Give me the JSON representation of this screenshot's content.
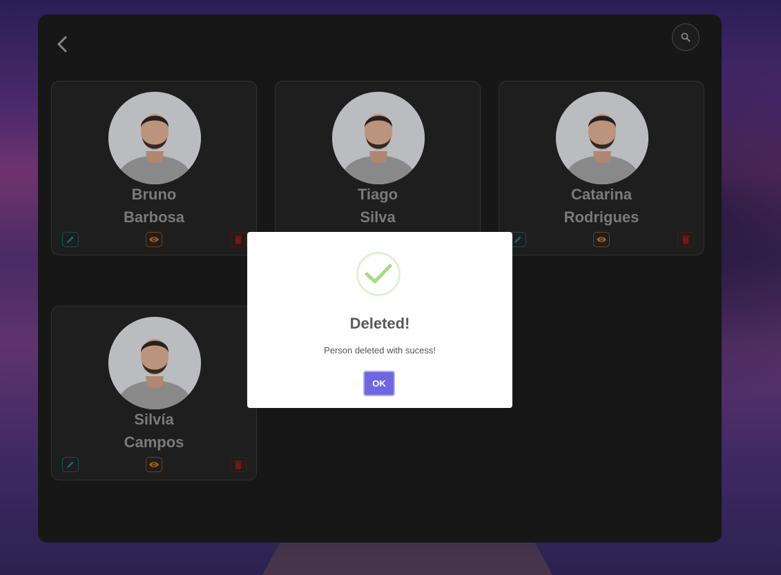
{
  "colors": {
    "panel": "#1b1b1b",
    "card_border": "#3a3a3a",
    "name_text": "#8b8b8b",
    "edit_accent": "#1e6f7c",
    "view_accent": "#c06a10",
    "delete_accent": "#8a1818",
    "success_check": "#a5dc86",
    "ok_button": "#7066e0"
  },
  "header": {
    "back_icon": "chevron-left-icon",
    "search_icon": "search-icon"
  },
  "people": [
    {
      "first_name": "Bruno",
      "last_name": "Barbosa"
    },
    {
      "first_name": "Tiago",
      "last_name": "Silva"
    },
    {
      "first_name": "Catarina",
      "last_name": "Rodrigues"
    },
    {
      "first_name": "Silvía",
      "last_name": "Campos"
    }
  ],
  "card_actions": {
    "edit_icon": "pencil-icon",
    "view_icon": "eye-icon",
    "delete_icon": "trash-icon"
  },
  "dialog": {
    "icon": "checkmark-icon",
    "title": "Deleted!",
    "message": "Person deleted with sucess!",
    "confirm_label": "OK"
  }
}
